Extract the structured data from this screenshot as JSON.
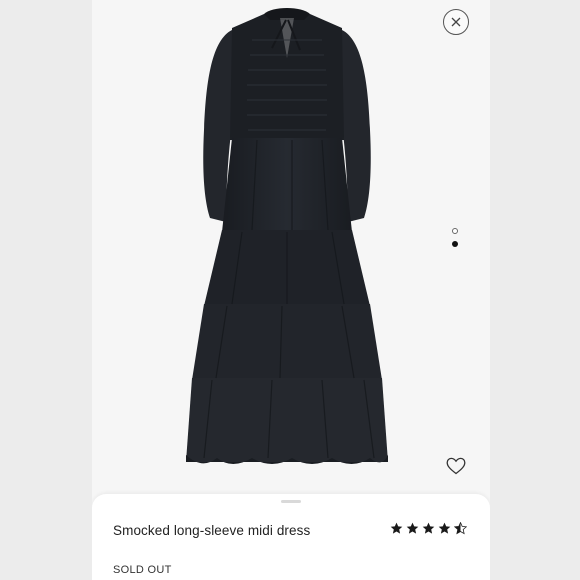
{
  "product": {
    "title": "Smocked long-sleeve midi dress",
    "status": "SOLD OUT",
    "rating_value": 4.5,
    "rating_max": 5
  },
  "carousel": {
    "total_slides": 2,
    "active_slide": 2
  },
  "icons": {
    "close": "close-icon",
    "wishlist": "heart-outline-icon",
    "star": "star-icon"
  },
  "colors": {
    "dress": "#1e2127",
    "background": "#f6f6f6",
    "sheet": "#ffffff",
    "text": "#222222"
  }
}
